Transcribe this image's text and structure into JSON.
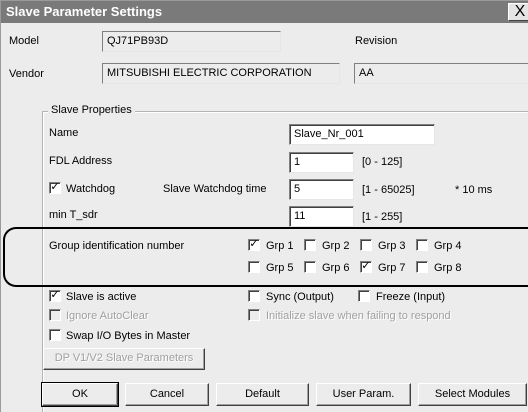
{
  "window": {
    "title": "Slave Parameter Settings",
    "close_symbol": "X"
  },
  "info": {
    "model_label": "Model",
    "model_value": "QJ71PB93D",
    "revision_label": "Revision",
    "vendor_label": "Vendor",
    "vendor_value": "MITSUBISHI ELECTRIC CORPORATION",
    "revision_value": "AA"
  },
  "slave_properties": {
    "title": "Slave Properties",
    "name_label": "Name",
    "name_value": "Slave_Nr_001",
    "fdl_label": "FDL Address",
    "fdl_value": "1",
    "fdl_range": "[0 - 125]",
    "watchdog_label": "Watchdog",
    "watchdog_checked": true,
    "wd_time_label": "Slave Watchdog time",
    "wd_time_value": "5",
    "wd_time_range": "[1 - 65025]",
    "wd_time_unit": "* 10 ms",
    "tsdr_label": "min T_sdr",
    "tsdr_value": "11",
    "tsdr_range": "[1 - 255]"
  },
  "groups": {
    "label": "Group identification number",
    "items": [
      {
        "label": "Grp 1",
        "checked": true
      },
      {
        "label": "Grp 2",
        "checked": false
      },
      {
        "label": "Grp 3",
        "checked": false
      },
      {
        "label": "Grp 4",
        "checked": false
      },
      {
        "label": "Grp 5",
        "checked": false
      },
      {
        "label": "Grp 6",
        "checked": false
      },
      {
        "label": "Grp 7",
        "checked": true
      },
      {
        "label": "Grp 8",
        "checked": false
      }
    ]
  },
  "options": {
    "slave_active": {
      "label": "Slave is active",
      "checked": true
    },
    "sync_output": {
      "label": "Sync (Output)",
      "checked": false
    },
    "freeze_input": {
      "label": "Freeze (Input)",
      "checked": false
    },
    "ignore_autoclear": {
      "label": "Ignore AutoClear",
      "checked": false,
      "enabled": false
    },
    "init_slave": {
      "label": "Initialize slave when failing to respond",
      "checked": false,
      "enabled": false
    },
    "swap_io": {
      "label": "Swap I/O Bytes in Master",
      "checked": false
    }
  },
  "dpv_button": "DP V1/V2 Slave Parameters",
  "buttons": {
    "ok": "OK",
    "cancel": "Cancel",
    "default": "Default",
    "user_param": "User Param.",
    "select_modules": "Select Modules"
  },
  "check_mark": "✓"
}
